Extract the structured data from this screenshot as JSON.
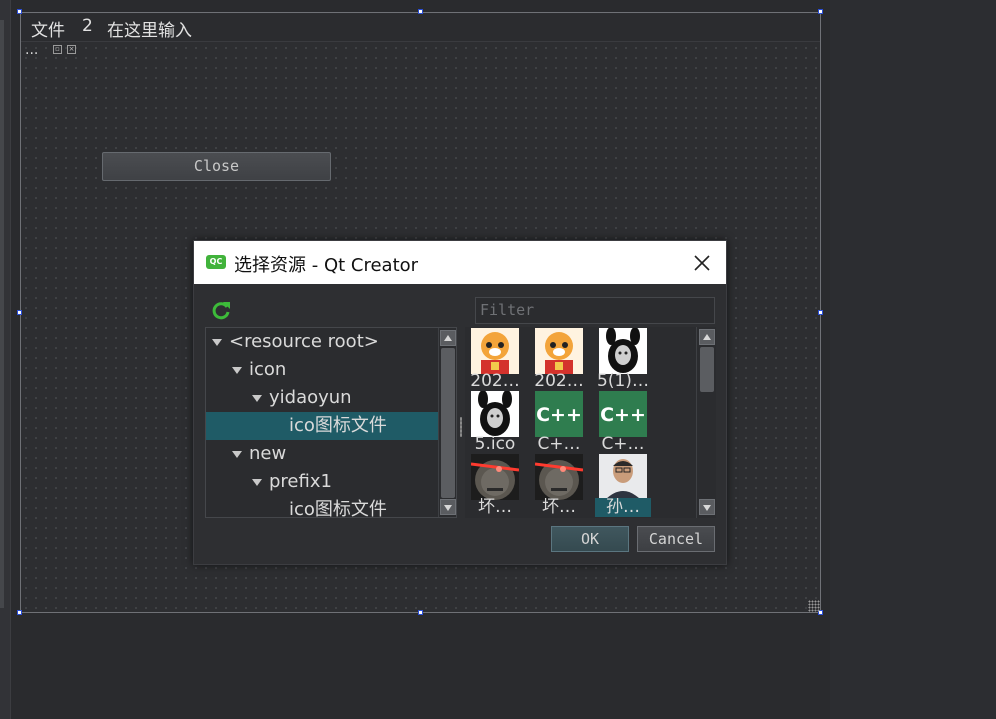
{
  "menubar": {
    "items": [
      "文件",
      "2",
      "在这里输入"
    ]
  },
  "form": {
    "dots": "...",
    "close_button": "Close"
  },
  "dialog": {
    "title": "选择资源 - Qt Creator",
    "logo_text": "QC",
    "filter_placeholder": "Filter",
    "tree": [
      {
        "label": "<resource root>",
        "level": 0,
        "expanded": true
      },
      {
        "label": "icon",
        "level": 1,
        "expanded": true
      },
      {
        "label": "yidaoyun",
        "level": 2,
        "expanded": true
      },
      {
        "label": "ico图标文件",
        "level": 3,
        "selected": true
      },
      {
        "label": "new",
        "level": 1,
        "expanded": true
      },
      {
        "label": "prefix1",
        "level": 2,
        "expanded": true
      },
      {
        "label": "ico图标文件",
        "level": 3
      }
    ],
    "icons": [
      {
        "label": "202…",
        "kind": "tiger"
      },
      {
        "label": "202…",
        "kind": "tiger"
      },
      {
        "label": "5(1)…",
        "kind": "bunny-face"
      },
      {
        "label": "5.ico",
        "kind": "bunny-face"
      },
      {
        "label": "C+…",
        "kind": "cpp"
      },
      {
        "label": "C+…",
        "kind": "cpp"
      },
      {
        "label": "坏…",
        "kind": "laser-face"
      },
      {
        "label": "坏…",
        "kind": "laser-face"
      },
      {
        "label": "孙…",
        "kind": "portrait",
        "selected": true
      }
    ],
    "ok_label": "OK",
    "cancel_label": "Cancel"
  },
  "colors": {
    "selection": "#1f5b66",
    "handle_border": "#2c4fd6",
    "cpp_green": "#2f7d4f"
  }
}
